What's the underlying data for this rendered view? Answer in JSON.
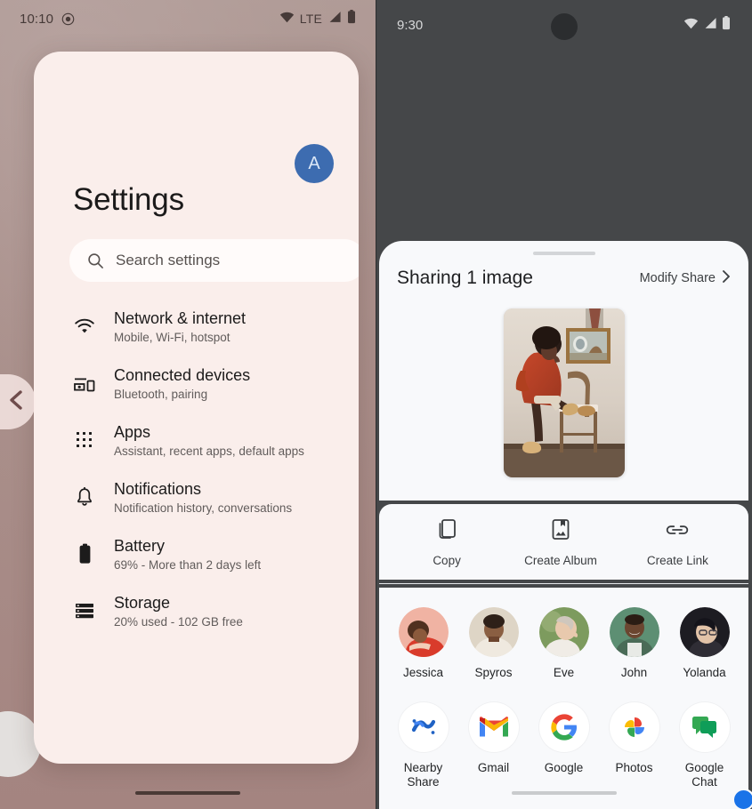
{
  "left_phone": {
    "status_bar": {
      "time": "10:10",
      "recording_icon": "screen-record-icon",
      "wifi_icon": "wifi-icon",
      "network_label": "LTE",
      "signal_icon": "signal-icon",
      "battery_icon": "battery-icon"
    },
    "app_title": "Settings",
    "avatar_initial": "A",
    "avatar_color": "#3d6cb0",
    "search": {
      "icon": "search-icon",
      "placeholder": "Search settings"
    },
    "items": [
      {
        "icon": "wifi-icon",
        "title": "Network & internet",
        "subtitle": "Mobile, Wi-Fi, hotspot"
      },
      {
        "icon": "devices-icon",
        "title": "Connected devices",
        "subtitle": "Bluetooth, pairing"
      },
      {
        "icon": "apps-grid-icon",
        "title": "Apps",
        "subtitle": "Assistant, recent apps, default apps"
      },
      {
        "icon": "bell-icon",
        "title": "Notifications",
        "subtitle": "Notification history, conversations"
      },
      {
        "icon": "battery-icon",
        "title": "Battery",
        "subtitle": "69% - More than 2 days left"
      },
      {
        "icon": "storage-icon",
        "title": "Storage",
        "subtitle": "20% used - 102 GB free"
      }
    ],
    "back_gesture_icon": "chevron-left-icon",
    "card_background": "#faeeeb"
  },
  "right_phone": {
    "status_bar": {
      "time": "9:30",
      "wifi_icon": "wifi-icon",
      "signal_icon": "signal-icon",
      "battery_icon": "battery-icon"
    },
    "sheet": {
      "title": "Sharing 1 image",
      "modify_label": "Modify Share",
      "modify_chevron_icon": "chevron-right-icon",
      "grabber": "drag-handle"
    },
    "actions": [
      {
        "icon": "copy-icon",
        "label": "Copy"
      },
      {
        "icon": "create-album-icon",
        "label": "Create Album"
      },
      {
        "icon": "link-icon",
        "label": "Create Link"
      }
    ],
    "people": [
      {
        "name": "Jessica",
        "badge": "messages-icon",
        "badge_color": "#1a73e8"
      },
      {
        "name": "Spyros",
        "badge": "google-chat-icon",
        "badge_color": "#ffffff"
      },
      {
        "name": "Eve",
        "badge": "messages-icon",
        "badge_color": "#1a73e8"
      },
      {
        "name": "John",
        "badge": "google-chat-icon",
        "badge_color": "#ffffff"
      },
      {
        "name": "Yolanda",
        "badge": "messages-icon",
        "badge_color": "#1a73e8"
      }
    ],
    "apps": [
      {
        "icon": "nearby-share-icon",
        "name": "Nearby\nShare"
      },
      {
        "icon": "gmail-icon",
        "name": "Gmail"
      },
      {
        "icon": "google-icon",
        "name": "Google"
      },
      {
        "icon": "photos-icon",
        "name": "Photos"
      },
      {
        "icon": "google-chat-icon",
        "name": "Google\nChat"
      }
    ]
  }
}
